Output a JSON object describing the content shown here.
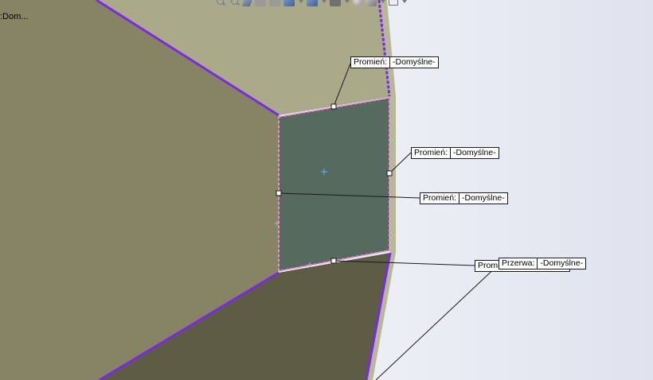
{
  "colors": {
    "background_left": "#ffffff",
    "background_right": "#dfe3ee",
    "face_large": "#868465",
    "face_top": "#aaa98a",
    "face_bottom": "#5d5c45",
    "face_selected": "#566a60",
    "edge_purple": "#7a2ae0",
    "edge_pink": "#f08ad8",
    "leader_line": "#1a1a1a"
  },
  "toolbar": {
    "icons": [
      "zoom-to-fit-icon",
      "zoom-to-area-icon",
      "previous-view-icon",
      "section-view-icon",
      "dynamic-annotation-icon",
      "view-orientation-icon",
      "display-style-icon",
      "hide-show-items-icon",
      "edit-appearance-icon",
      "apply-scene-icon",
      "view-settings-icon"
    ]
  },
  "tree": {
    "label": ":Dom..."
  },
  "callouts": [
    {
      "name": "callout-promien-1",
      "label": "Promień:",
      "value": "-Domyślne-"
    },
    {
      "name": "callout-promien-2",
      "label": "Promień:",
      "value": "-Domyślne-"
    },
    {
      "name": "callout-promien-3",
      "label": "Promień:",
      "value": "-Domyślne-"
    },
    {
      "name": "callout-promien-4",
      "label": "Promi",
      "value": ""
    },
    {
      "name": "callout-przerwa",
      "label": "Przerwa:",
      "value": "-Domyślne-"
    }
  ]
}
